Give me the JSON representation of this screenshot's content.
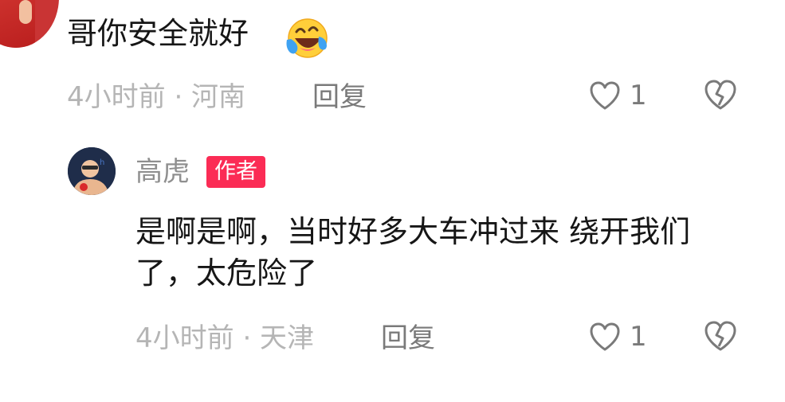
{
  "comment": {
    "text": "哥你安全就好",
    "emoji_icon": "laughing-crying-emoji-icon",
    "meta": "4小时前 · 河南",
    "reply_label": "回复",
    "like_count": "1"
  },
  "reply": {
    "author": "高虎",
    "badge": "作者",
    "text": "是啊是啊，当时好多大车冲过来 绕开我们了，太危险了",
    "meta": "4小时前 · 天津",
    "reply_label": "回复",
    "like_count": "1"
  },
  "colors": {
    "badge_bg": "#fb2c55",
    "meta_gray": "#b5b5b5",
    "text_dark": "#161616"
  }
}
